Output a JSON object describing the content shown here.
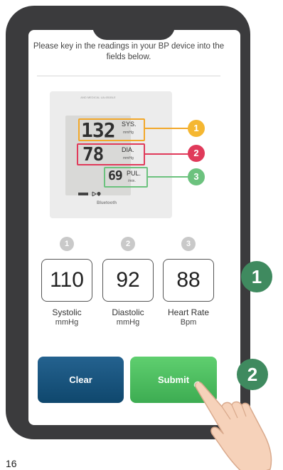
{
  "instruction": "Please key in the readings in your BP device into the fields below.",
  "device": {
    "header_text": "AND MEDICAL UA-651BLE",
    "systolic_display": "132",
    "diastolic_display": "78",
    "pulse_display": "69",
    "sys_tag": "SYS.",
    "sys_unit": "mmHg",
    "dia_tag": "DIA.",
    "dia_unit": "mmHg",
    "pul_tag": "PUL.",
    "pul_unit": "/min.",
    "bluetooth_label": "Bluetooth",
    "markers": [
      "1",
      "2",
      "3"
    ],
    "marker_colors": [
      "#f5b731",
      "#e03a5a",
      "#6cc27e"
    ]
  },
  "steps": [
    "1",
    "2",
    "3"
  ],
  "fields": [
    {
      "value": "110",
      "label": "Systolic",
      "unit": "mmHg"
    },
    {
      "value": "92",
      "label": "Diastolic",
      "unit": "mmHg"
    },
    {
      "value": "88",
      "label": "Heart Rate",
      "unit": "Bpm"
    }
  ],
  "buttons": {
    "clear_label": "Clear",
    "submit_label": "Submit",
    "clear_color": "#1a5680",
    "submit_color": "#4cbf60"
  },
  "callouts": [
    "1",
    "2"
  ],
  "page_number": "16",
  "icons": [
    "bluetooth-icon",
    "heart-icon",
    "pointing-hand-icon"
  ]
}
